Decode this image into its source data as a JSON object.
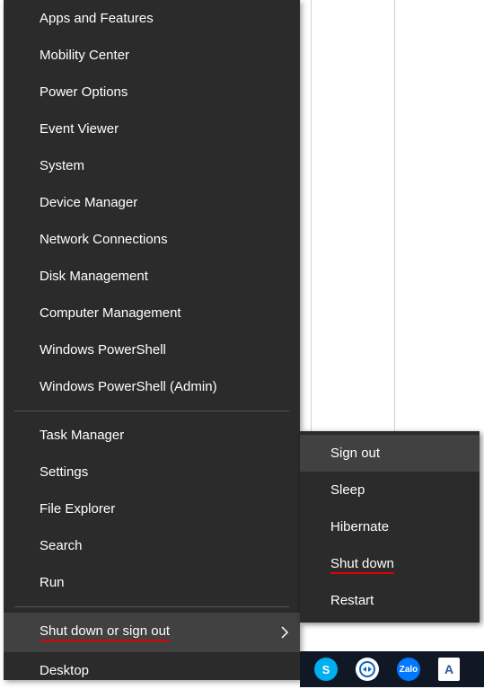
{
  "menu": {
    "group1": [
      "Apps and Features",
      "Mobility Center",
      "Power Options",
      "Event Viewer",
      "System",
      "Device Manager",
      "Network Connections",
      "Disk Management",
      "Computer Management",
      "Windows PowerShell",
      "Windows PowerShell (Admin)"
    ],
    "group2": [
      "Task Manager",
      "Settings",
      "File Explorer",
      "Search",
      "Run"
    ],
    "group3": {
      "shutdown_label": "Shut down or sign out"
    },
    "group4": [
      "Desktop"
    ]
  },
  "submenu": {
    "signout": "Sign out",
    "sleep": "Sleep",
    "hibernate": "Hibernate",
    "shutdown": "Shut down",
    "restart": "Restart"
  },
  "taskbar": {
    "skype": "S",
    "zalo": "Zalo",
    "word": "A"
  }
}
